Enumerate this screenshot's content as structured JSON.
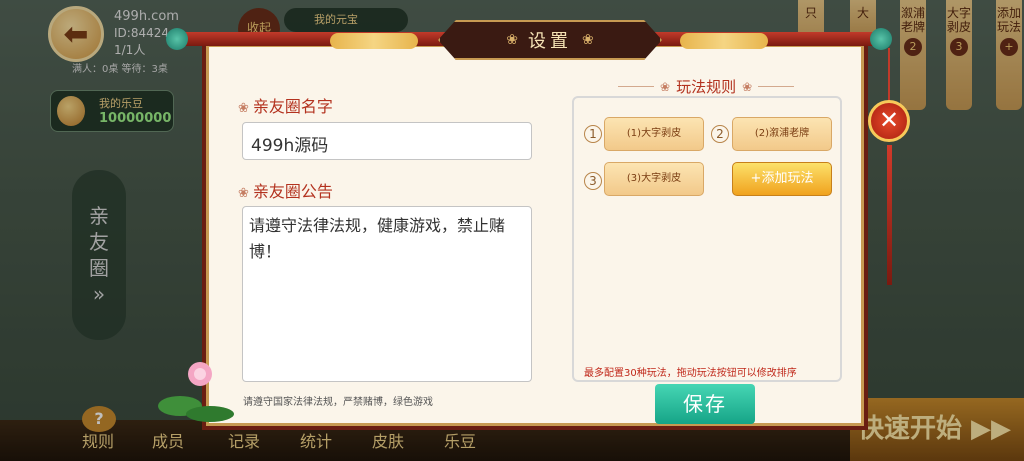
{
  "background": {
    "site": "499h.com",
    "room_id": "ID:84424",
    "player_count": "1/1人",
    "room_stats": "满人：0桌  等待：3桌",
    "collapse_label": "收起",
    "yuanbao_label": "我的元宝",
    "ledou_label": "我的乐豆",
    "ledou_value": "10000000",
    "side_friends_label": [
      "亲",
      "友",
      "圈",
      "»"
    ],
    "banners": [
      {
        "text": "只",
        "num": ""
      },
      {
        "text": "大",
        "num": ""
      },
      {
        "text": "溆浦老牌",
        "num": "2"
      },
      {
        "text": "大字剥皮",
        "num": "3"
      },
      {
        "text": "添加玩法",
        "num": "+"
      }
    ],
    "bottom_items": [
      "规则",
      "成员",
      "记录",
      "统计",
      "皮肤",
      "乐豆"
    ],
    "quick_start": "快速开始 ▶▶"
  },
  "dialog": {
    "title": "设置",
    "name_label": "亲友圈名字",
    "name_value": "499h源码",
    "notice_label": "亲友圈公告",
    "notice_text": "请遵守法律法规，健康游戏，禁止赌博！",
    "notice_hint": "请遵守国家法律法规，严禁赌博，绿色游戏",
    "rules_title": "玩法规则",
    "rules": [
      {
        "num": "1",
        "label": "(1)大字剥皮"
      },
      {
        "num": "2",
        "label": "(2)溆浦老牌"
      },
      {
        "num": "3",
        "label": "(3)大字剥皮"
      }
    ],
    "add_rule_label": "+添加玩法",
    "rules_hint": "最多配置30种玩法，拖动玩法按钮可以修改排序",
    "save_label": "保存",
    "close_symbol": "✕"
  }
}
